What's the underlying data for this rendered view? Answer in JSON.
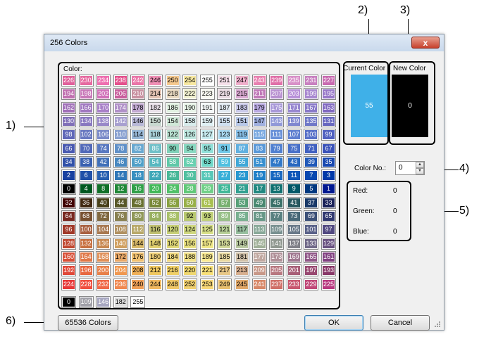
{
  "callouts": {
    "n1": "1)",
    "n2": "2)",
    "n3": "3)",
    "n4": "4)",
    "n5": "5)",
    "n6": "6)"
  },
  "window": {
    "title": "256 Colors",
    "close_glyph": "x"
  },
  "palette": {
    "label": "Color:",
    "rows": [
      [
        226,
        230,
        234,
        238,
        242,
        246,
        250,
        254,
        255,
        251,
        247,
        243,
        239,
        235,
        231,
        227
      ],
      [
        194,
        198,
        202,
        206,
        210,
        214,
        218,
        222,
        223,
        219,
        215,
        211,
        207,
        203,
        199,
        195
      ],
      [
        162,
        166,
        170,
        174,
        178,
        182,
        186,
        190,
        191,
        187,
        183,
        179,
        175,
        171,
        167,
        163
      ],
      [
        130,
        134,
        138,
        142,
        146,
        150,
        154,
        158,
        159,
        155,
        151,
        147,
        143,
        139,
        135,
        131
      ],
      [
        98,
        102,
        106,
        110,
        114,
        118,
        122,
        126,
        127,
        123,
        119,
        115,
        111,
        107,
        103,
        99
      ],
      [
        66,
        70,
        74,
        78,
        82,
        86,
        90,
        94,
        95,
        91,
        87,
        83,
        79,
        75,
        71,
        67
      ],
      [
        34,
        38,
        42,
        46,
        50,
        54,
        58,
        62,
        63,
        59,
        55,
        51,
        47,
        43,
        39,
        35
      ],
      [
        2,
        6,
        10,
        14,
        18,
        22,
        26,
        30,
        31,
        27,
        23,
        19,
        15,
        11,
        7,
        3
      ],
      [
        0,
        4,
        8,
        12,
        16,
        20,
        24,
        28,
        29,
        25,
        21,
        17,
        13,
        9,
        5,
        1
      ],
      [
        32,
        36,
        40,
        44,
        48,
        52,
        56,
        60,
        61,
        57,
        53,
        49,
        45,
        41,
        37,
        33
      ],
      [
        64,
        68,
        72,
        76,
        80,
        84,
        88,
        92,
        93,
        89,
        85,
        81,
        77,
        73,
        69,
        65
      ],
      [
        96,
        100,
        104,
        108,
        112,
        116,
        120,
        124,
        125,
        121,
        117,
        113,
        109,
        105,
        101,
        97
      ],
      [
        128,
        132,
        136,
        140,
        144,
        148,
        152,
        156,
        157,
        153,
        149,
        145,
        141,
        137,
        133,
        129
      ],
      [
        160,
        164,
        168,
        172,
        176,
        180,
        184,
        188,
        189,
        185,
        181,
        177,
        173,
        169,
        165,
        161
      ],
      [
        192,
        196,
        200,
        204,
        208,
        212,
        216,
        220,
        221,
        217,
        213,
        209,
        205,
        201,
        197,
        193
      ],
      [
        224,
        228,
        232,
        236,
        240,
        244,
        248,
        252,
        253,
        249,
        245,
        241,
        237,
        233,
        229,
        225
      ]
    ],
    "row_colors": [
      [
        "#e0609a",
        "#e66aa0",
        "#ee6fb0",
        "#e4508c",
        "#ea76a8",
        "#f090b5",
        "#f5c98f",
        "#f8e9a2",
        "#ffffff",
        "#f6e0ea",
        "#f0b0cc",
        "#e880b0",
        "#e070a8",
        "#d890c8",
        "#c880c0",
        "#c86ab0"
      ],
      [
        "#c070b0",
        "#c878b8",
        "#d070b8",
        "#c85e9c",
        "#c890a0",
        "#e0c0b0",
        "#e8d8c0",
        "#f0f0d0",
        "#f8f8f0",
        "#e8d8e0",
        "#d8a8d0",
        "#c078b8",
        "#b890d0",
        "#b890d8",
        "#a888d0",
        "#9878c8"
      ],
      [
        "#a070b8",
        "#a078c0",
        "#a880c8",
        "#b090c8",
        "#c0a8d0",
        "#e8e0e8",
        "#e0f0e0",
        "#e8f4e8",
        "#f4f8f8",
        "#e0e8f0",
        "#c8c8e8",
        "#b8a8e0",
        "#a898d8",
        "#9888d0",
        "#8878c8",
        "#8068c0"
      ],
      [
        "#8070b8",
        "#8878c0",
        "#9888c8",
        "#a8a0d0",
        "#b8b8d8",
        "#c8d8d0",
        "#d0e8d8",
        "#d8ecec",
        "#e0f0f4",
        "#d0e0f0",
        "#b8c8e8",
        "#a0b0e0",
        "#9098d8",
        "#8088d0",
        "#7078c8",
        "#6868c0"
      ],
      [
        "#6068b8",
        "#6878c0",
        "#7888c8",
        "#88a0d0",
        "#98b8d8",
        "#a8d0d8",
        "#b8e0d0",
        "#c0e8e0",
        "#c8ecf0",
        "#a8d8f0",
        "#88c0e8",
        "#78a8e0",
        "#6890d8",
        "#6080d0",
        "#5870c8",
        "#5060c0"
      ],
      [
        "#4858b0",
        "#5068b8",
        "#5878c0",
        "#6090c8",
        "#68a8d0",
        "#70c0c8",
        "#80d0b8",
        "#88d8c0",
        "#90e0d8",
        "#70c8e8",
        "#60b0e0",
        "#5898d8",
        "#5080d0",
        "#4870c8",
        "#4060c0",
        "#3850b8"
      ],
      [
        "#3050a8",
        "#3860b0",
        "#4070b8",
        "#4888c0",
        "#50a0c8",
        "#58b8c0",
        "#60c8a8",
        "#68d0b0",
        "#70d8c8",
        "#50c0e0",
        "#40a8d8",
        "#3890d0",
        "#3078c8",
        "#2868c0",
        "#2058b8",
        "#1848b0"
      ],
      [
        "#1840a0",
        "#2050a8",
        "#2860b0",
        "#3078b8",
        "#3890c0",
        "#40a8b8",
        "#48b898",
        "#50c0a0",
        "#58c8b8",
        "#38b0d8",
        "#2898d0",
        "#2080c8",
        "#1868c0",
        "#1058b8",
        "#0848b0",
        "#0038a8"
      ],
      [
        "#000000",
        "#005820",
        "#107028",
        "#208838",
        "#30a048",
        "#40b858",
        "#50c068",
        "#60c878",
        "#70d088",
        "#40b898",
        "#30a090",
        "#208880",
        "#107070",
        "#005868",
        "#003880",
        "#001890"
      ],
      [
        "#400000",
        "#402810",
        "#484018",
        "#585828",
        "#687030",
        "#788838",
        "#88a040",
        "#98b048",
        "#a8c050",
        "#78b070",
        "#58a078",
        "#488870",
        "#387068",
        "#285860",
        "#183868",
        "#182058"
      ],
      [
        "#782820",
        "#785030",
        "#806840",
        "#888050",
        "#909858",
        "#98b060",
        "#a8c068",
        "#b8c870",
        "#c0d078",
        "#98c088",
        "#78b090",
        "#689888",
        "#588080",
        "#486878",
        "#3c5078",
        "#303870"
      ],
      [
        "#a03828",
        "#a86040",
        "#a87850",
        "#b09060",
        "#b8a868",
        "#c0c070",
        "#c8d078",
        "#d0d880",
        "#d8e088",
        "#b8d098",
        "#98c0a0",
        "#88a898",
        "#789090",
        "#687888",
        "#586088",
        "#504880"
      ],
      [
        "#c04830",
        "#c87040",
        "#c88850",
        "#d0a060",
        "#d8b868",
        "#e0d070",
        "#e0d878",
        "#e8e080",
        "#f0e888",
        "#d0d898",
        "#b8c8a0",
        "#a0b098",
        "#909890",
        "#808088",
        "#706888",
        "#685080"
      ],
      [
        "#d85038",
        "#e07848",
        "#e09058",
        "#e8a868",
        "#f0c070",
        "#f0d078",
        "#f0d880",
        "#f0e088",
        "#f8e890",
        "#e8d8a0",
        "#d0c0a8",
        "#c0a8a0",
        "#b09098",
        "#a07890",
        "#905888",
        "#804080"
      ],
      [
        "#e04838",
        "#e86840",
        "#e88048",
        "#f09850",
        "#f0b058",
        "#f0c860",
        "#f0d068",
        "#f0d870",
        "#f8e078",
        "#e8c888",
        "#d8b090",
        "#c89888",
        "#b87880",
        "#a86078",
        "#984870",
        "#883868"
      ],
      [
        "#e83838",
        "#f05040",
        "#f06848",
        "#f08850",
        "#f0a058",
        "#f0b860",
        "#f0c868",
        "#f0d070",
        "#f8d878",
        "#e8c070",
        "#e0a868",
        "#d88868",
        "#d07068",
        "#c85870",
        "#c04878",
        "#b83880"
      ]
    ],
    "special": [
      {
        "value": "0",
        "color": "#000000",
        "text": "#ffffff"
      },
      {
        "value": "109",
        "color": "#a0a0a8",
        "text": "#ffffff"
      },
      {
        "value": "146",
        "color": "#a6a6c0",
        "text": "#ffffff"
      },
      {
        "value": "182",
        "color": "#dcdcdc",
        "text": "#000000"
      },
      {
        "value": "255",
        "color": "#ffffff",
        "text": "#000000"
      }
    ]
  },
  "current_color": {
    "label": "Current Color",
    "value": "55",
    "color": "#3fb0e8"
  },
  "new_color": {
    "label": "New Color",
    "value": "0",
    "color": "#000000"
  },
  "color_no": {
    "label": "Color No.:",
    "value": "0"
  },
  "rgb": {
    "red_label": "Red:",
    "red": "0",
    "green_label": "Green:",
    "green": "0",
    "blue_label": "Blue:",
    "blue": "0"
  },
  "buttons": {
    "colors65536": "65536 Colors",
    "ok": "OK",
    "cancel": "Cancel"
  }
}
